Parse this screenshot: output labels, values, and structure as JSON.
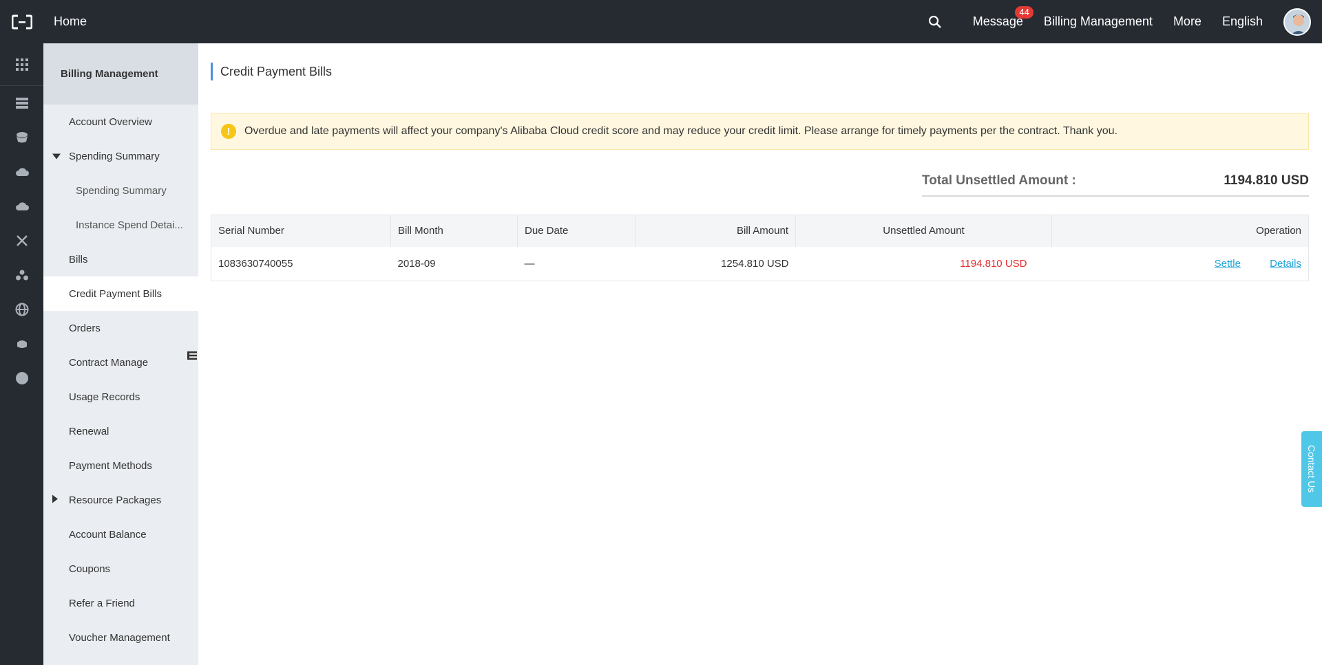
{
  "header": {
    "home": "Home",
    "message": "Message",
    "message_count": "44",
    "billing": "Billing Management",
    "more": "More",
    "language": "English"
  },
  "sidebar": {
    "title": "Billing Management",
    "items": [
      {
        "label": "Account Overview"
      },
      {
        "label": "Spending Summary"
      },
      {
        "label": "Spending Summary"
      },
      {
        "label": "Instance Spend Detai..."
      },
      {
        "label": "Bills"
      },
      {
        "label": "Credit Payment Bills"
      },
      {
        "label": "Orders"
      },
      {
        "label": "Contract Manage"
      },
      {
        "label": "Usage Records"
      },
      {
        "label": "Renewal"
      },
      {
        "label": "Payment Methods"
      },
      {
        "label": "Resource Packages"
      },
      {
        "label": "Account Balance"
      },
      {
        "label": "Coupons"
      },
      {
        "label": "Refer a Friend"
      },
      {
        "label": "Voucher Management"
      }
    ]
  },
  "main": {
    "title": "Credit Payment Bills",
    "alert": "Overdue and late payments will affect your company's Alibaba Cloud credit score and may reduce your credit limit. Please arrange for timely payments per the contract. Thank you.",
    "total_label": "Total Unsettled Amount :",
    "total_value": "1194.810 USD",
    "table": {
      "headers": [
        "Serial Number",
        "Bill Month",
        "Due Date",
        "Bill Amount",
        "Unsettled Amount",
        "Operation"
      ],
      "rows": [
        {
          "serial": "1083630740055",
          "month": "2018-09",
          "due": "—",
          "amount": "1254.810 USD",
          "unsettled": "1194.810 USD",
          "settle": "Settle",
          "details": "Details"
        }
      ]
    }
  },
  "contact": "Contact Us",
  "colors": {
    "topbar": "#262b32",
    "accent": "#4a90e2",
    "link": "#20a4d8",
    "danger": "#e52b2b",
    "contact": "#4fc8e8"
  }
}
